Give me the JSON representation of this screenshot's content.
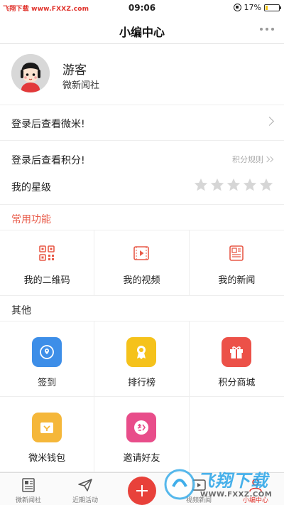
{
  "status_bar": {
    "carrier_text": "飞翔下载 www.FXXZ.com",
    "time": "09:06",
    "battery_text": "17%",
    "battery_level": 0.17
  },
  "header": {
    "title": "小编中心",
    "more_icon": "more-dots-icon"
  },
  "profile": {
    "name": "游客",
    "organization": "微新闻社"
  },
  "rows": {
    "micoin_label": "登录后查看微米!",
    "points_label": "登录后查看积分!",
    "points_rules": "积分规则",
    "stars_label": "我的星级",
    "stars_filled": 0,
    "stars_total": 5
  },
  "common_section": {
    "title": "常用功能",
    "items": [
      {
        "label": "我的二维码",
        "icon": "qrcode-icon"
      },
      {
        "label": "我的视频",
        "icon": "video-icon"
      },
      {
        "label": "我的新闻",
        "icon": "news-icon"
      }
    ]
  },
  "other_section": {
    "title": "其他",
    "items": [
      {
        "label": "签到",
        "icon": "checkin-icon"
      },
      {
        "label": "排行榜",
        "icon": "ranking-icon"
      },
      {
        "label": "积分商城",
        "icon": "gift-icon"
      },
      {
        "label": "微米钱包",
        "icon": "wallet-icon"
      },
      {
        "label": "邀请好友",
        "icon": "invite-icon"
      }
    ]
  },
  "tabbar": {
    "tabs": [
      {
        "label": "微新闻社",
        "icon": "newspaper-icon"
      },
      {
        "label": "近期活动",
        "icon": "paper-plane-icon"
      },
      {
        "label": "视频新闻",
        "icon": "video-news-icon"
      },
      {
        "label": "小编中心",
        "icon": "user-center-icon"
      }
    ],
    "center_button_icon": "plus-icon"
  },
  "watermark": {
    "text": "飞翔下载",
    "url": "WWW.FXXZ.COM"
  },
  "colors": {
    "accent": "#e85a48",
    "tab_active": "#e0322b",
    "checkin_tile": "#3d8ee8",
    "ranking_tile": "#f5c21b",
    "gift_tile": "#ec5148",
    "wallet_tile": "#f5b73a",
    "invite_tile": "#e84d8a"
  }
}
